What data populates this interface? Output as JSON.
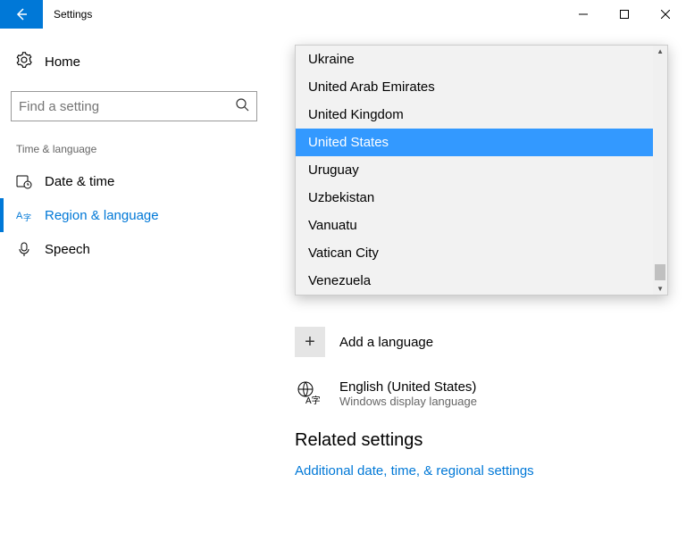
{
  "window": {
    "title": "Settings"
  },
  "sidebar": {
    "home": "Home",
    "search_placeholder": "Find a setting",
    "section": "Time & language",
    "items": [
      {
        "label": "Date & time"
      },
      {
        "label": "Region & language"
      },
      {
        "label": "Speech"
      }
    ]
  },
  "dropdown": {
    "options": [
      "Ukraine",
      "United Arab Emirates",
      "United Kingdom",
      "United States",
      "Uruguay",
      "Uzbekistan",
      "Vanuatu",
      "Vatican City",
      "Venezuela"
    ],
    "selected": "United States"
  },
  "main": {
    "add_language": "Add a language",
    "current_language": "English (United States)",
    "current_language_sub": "Windows display language",
    "related_heading": "Related settings",
    "related_link": "Additional date, time, & regional settings"
  }
}
